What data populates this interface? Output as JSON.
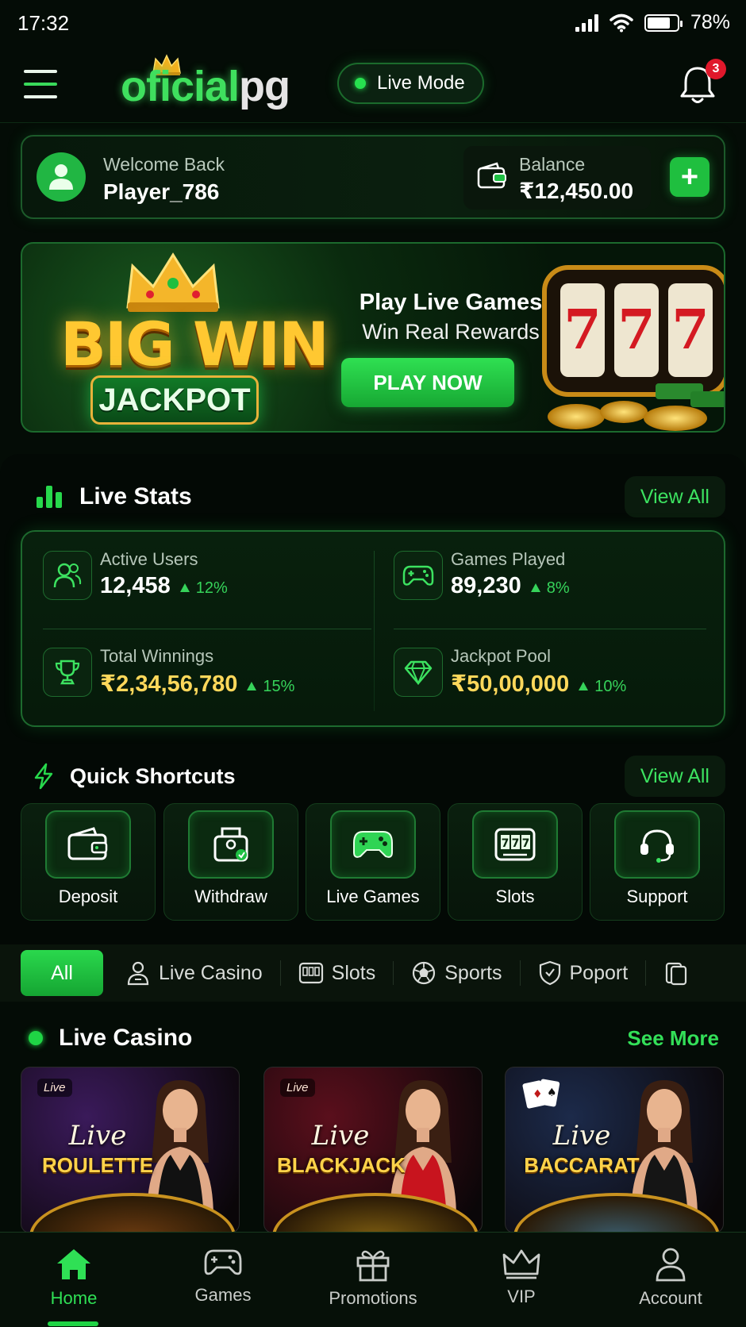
{
  "status_bar": {
    "time": "17:32",
    "battery": "78%",
    "battery_level": 0.78
  },
  "header": {
    "logo_left": "oficial",
    "logo_right": "pg",
    "live_mode_label": "Live Mode",
    "notification_count": "3"
  },
  "welcome": {
    "greeting": "Welcome Back",
    "player_name": "Player_786",
    "balance_label": "Balance",
    "balance_value": "₹12,450.00",
    "add_label": "+"
  },
  "banner": {
    "title_big": "BIG WIN",
    "title_jackpot": "JACKPOT",
    "line1": "Play Live Games",
    "line2": "Win Real Rewards",
    "cta": "PLAY NOW",
    "reel_digit": "7"
  },
  "live_stats": {
    "title": "Live Stats",
    "view_all": "View All",
    "items": [
      {
        "label": "Active Users",
        "value": "12,458",
        "change": "12%",
        "icon": "users-icon"
      },
      {
        "label": "Games Played",
        "value": "89,230",
        "change": "8%",
        "icon": "gamepad-icon"
      },
      {
        "label": "Total Winnings",
        "value": "₹2,34,56,780",
        "change": "15%",
        "icon": "trophy-icon"
      },
      {
        "label": "Jackpot Pool",
        "value": "₹50,00,000",
        "change": "10%",
        "icon": "diamond-icon"
      }
    ]
  },
  "shortcuts": {
    "title": "Quick Shortcuts",
    "view_all": "View All",
    "items": [
      {
        "label": "Deposit",
        "icon": "wallet-icon"
      },
      {
        "label": "Withdraw",
        "icon": "withdraw-icon"
      },
      {
        "label": "Live Games",
        "icon": "gamepad-icon"
      },
      {
        "label": "Slots",
        "icon": "slot-machine-icon"
      },
      {
        "label": "Support",
        "icon": "headset-icon"
      }
    ]
  },
  "categories": {
    "active": "All",
    "items": [
      {
        "label": "Live Casino",
        "icon": "dealer-icon"
      },
      {
        "label": "Slots",
        "icon": "slot-icon"
      },
      {
        "label": "Sports",
        "icon": "ball-icon"
      },
      {
        "label": "Poport",
        "icon": "shield-icon"
      }
    ]
  },
  "live_casino": {
    "title": "Live Casino",
    "see_more": "See More",
    "games": [
      {
        "badge": "Live",
        "live_word": "Live",
        "name": "ROULETTE",
        "bg": "#3a1a5a",
        "table": "#6a3a10",
        "dress": "#111111"
      },
      {
        "badge": "Live",
        "live_word": "Live",
        "name": "BLACKJACK",
        "bg": "#5a0f1c",
        "table": "#7a5a10",
        "dress": "#c8141e"
      },
      {
        "badge": "",
        "live_word": "Live",
        "name": "BACCARAT",
        "bg": "#1c2a4a",
        "table": "#3a5a6a",
        "dress": "#151515"
      }
    ]
  },
  "bottom_nav": {
    "items": [
      {
        "label": "Home",
        "icon": "home-icon",
        "active": true
      },
      {
        "label": "Games",
        "icon": "gamepad-icon"
      },
      {
        "label": "Promotions",
        "icon": "gift-icon"
      },
      {
        "label": "VIP",
        "icon": "crown-icon"
      },
      {
        "label": "Account",
        "icon": "user-icon"
      }
    ]
  },
  "colors": {
    "accent": "#27d84c",
    "gold": "#ffd85b",
    "background": "#040c06"
  }
}
